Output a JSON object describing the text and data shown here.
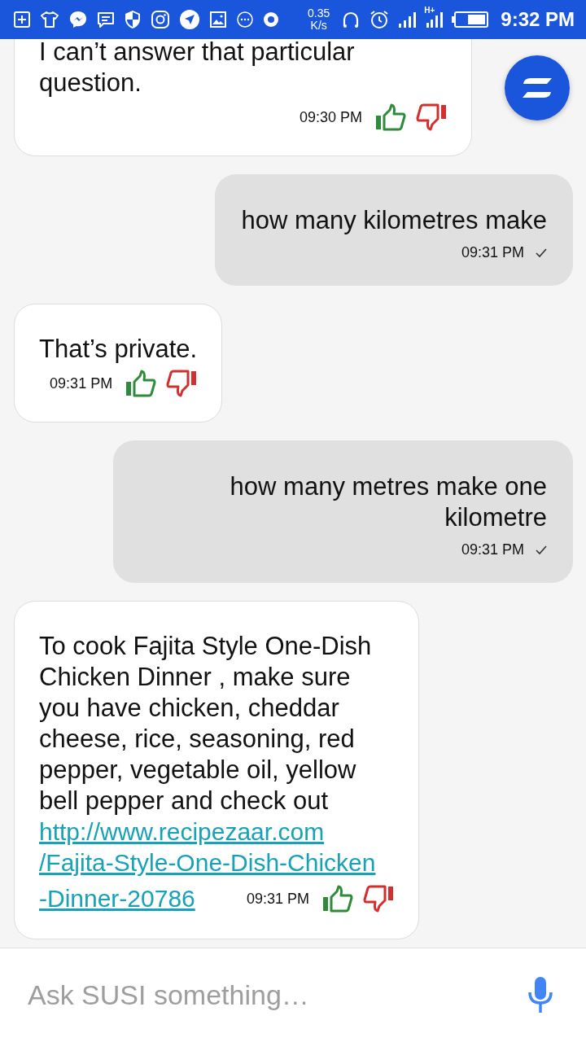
{
  "status_bar": {
    "speed": "0.35",
    "speed_unit": "K/s",
    "network": "H+",
    "time": "9:32 PM"
  },
  "messages": [
    {
      "kind": "bot",
      "text": "I can’t answer that particular question.",
      "time": "09:30 PM"
    },
    {
      "kind": "user",
      "text": "how many kilometres make",
      "time": "09:31 PM"
    },
    {
      "kind": "bot",
      "text": "That’s private.",
      "time": "09:31 PM"
    },
    {
      "kind": "user",
      "text": "how many metres make one kilometre",
      "time": "09:31 PM"
    },
    {
      "kind": "bot",
      "text": "To cook Fajita Style One-Dish Chicken Dinner , make sure you have chicken, cheddar cheese, rice, seasoning, red pepper, vegetable oil, yellow bell pepper and check out",
      "link_lines": [
        "http://www.recipezaar.com",
        "/Fajita-Style-One-Dish-Chicken",
        "-Dinner-20786"
      ],
      "time": "09:31 PM"
    }
  ],
  "input": {
    "placeholder": "Ask SUSI something…"
  }
}
